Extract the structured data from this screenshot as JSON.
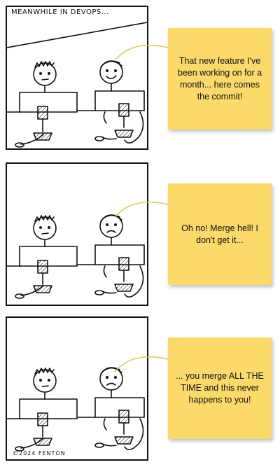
{
  "comic": {
    "caption": "MEANWHILE IN DEVOPS...",
    "copyright": "©2024 FENTON",
    "panels": [
      {
        "mood": "happy",
        "note": "That new feature I've been working on for a month... here comes the commit!"
      },
      {
        "mood": "worried",
        "note": "Oh no! Merge hell! I don't get it..."
      },
      {
        "mood": "worried",
        "note": "... you merge ALL THE TIME and this never happens to you!"
      }
    ]
  },
  "colors": {
    "note": "#fbd96a",
    "ink": "#111111",
    "background": "#ffffff"
  }
}
